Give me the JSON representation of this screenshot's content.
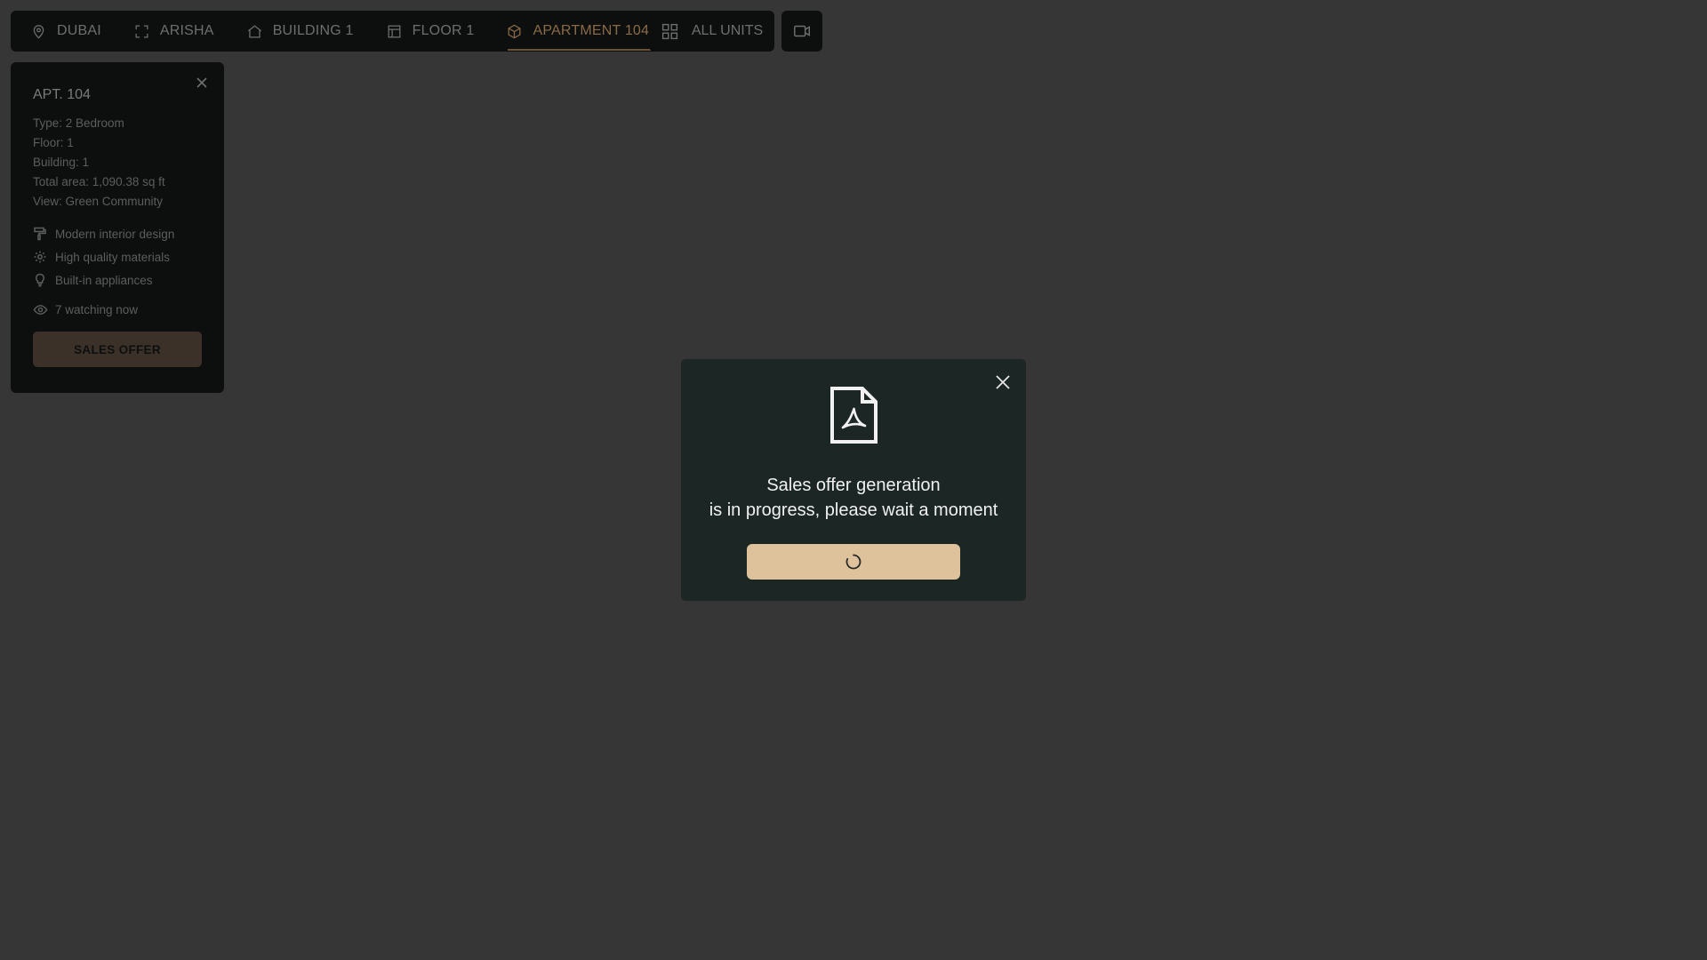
{
  "breadcrumbs": [
    {
      "label": "DUBAI",
      "icon": "map-pin-icon"
    },
    {
      "label": "ARISHA",
      "icon": "expand-icon"
    },
    {
      "label": "BUILDING 1",
      "icon": "home-icon"
    },
    {
      "label": "FLOOR 1",
      "icon": "floor-plan-icon"
    },
    {
      "label": "APARTMENT 104",
      "icon": "cube-icon",
      "active": true
    }
  ],
  "all_units": {
    "label": "ALL UNITS",
    "icon": "grid-icon"
  },
  "video_button": {
    "icon": "video-camera-icon"
  },
  "unit_panel": {
    "title": "APT. 104",
    "specs": [
      "Type: 2 Bedroom",
      "Floor: 1",
      "Building: 1",
      "Total area: 1,090.38 sq ft",
      "View: Green Community"
    ],
    "features": [
      {
        "label": "Modern interior design",
        "icon": "paint-roller-icon"
      },
      {
        "label": "High quality materials",
        "icon": "gear-icon"
      },
      {
        "label": "Built-in appliances",
        "icon": "lightbulb-icon"
      }
    ],
    "watching": "7 watching now",
    "sales_offer_label": "SALES OFFER"
  },
  "modal": {
    "icon": "pdf-file-icon",
    "message_line1": "Sales offer generation",
    "message_line2": "is in progress, please wait a moment",
    "button_state": "loading"
  },
  "colors": {
    "background": "#363636",
    "panel": "#0d0f0f",
    "modal": "#1b2625",
    "accent": "#ddc29c"
  }
}
